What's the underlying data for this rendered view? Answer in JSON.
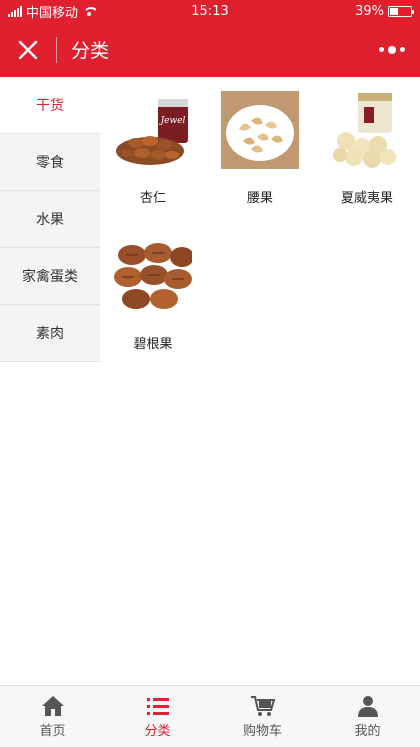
{
  "status_bar": {
    "carrier": "中国移动",
    "time": "15:13",
    "battery": "39%",
    "battery_level": 0.39
  },
  "nav": {
    "title": "分类"
  },
  "sidebar": {
    "items": [
      {
        "label": "干货",
        "active": true
      },
      {
        "label": "零食",
        "active": false
      },
      {
        "label": "水果",
        "active": false
      },
      {
        "label": "家禽蛋类",
        "active": false
      },
      {
        "label": "素肉",
        "active": false
      }
    ]
  },
  "products": [
    {
      "name": "杏仁",
      "image": "almonds-image"
    },
    {
      "name": "腰果",
      "image": "cashews-image"
    },
    {
      "name": "夏威夷果",
      "image": "macadamia-image"
    },
    {
      "name": "碧根果",
      "image": "pecans-image"
    }
  ],
  "tabbar": {
    "items": [
      {
        "label": "首页",
        "icon": "home-icon",
        "active": false
      },
      {
        "label": "分类",
        "icon": "list-icon",
        "active": true
      },
      {
        "label": "购物车",
        "icon": "cart-icon",
        "active": false
      },
      {
        "label": "我的",
        "icon": "profile-icon",
        "active": false
      }
    ]
  },
  "colors": {
    "brand": "#e0202f",
    "sidebar_bg": "#f4f4f4",
    "tabbar_bg": "#f7f7f7"
  }
}
